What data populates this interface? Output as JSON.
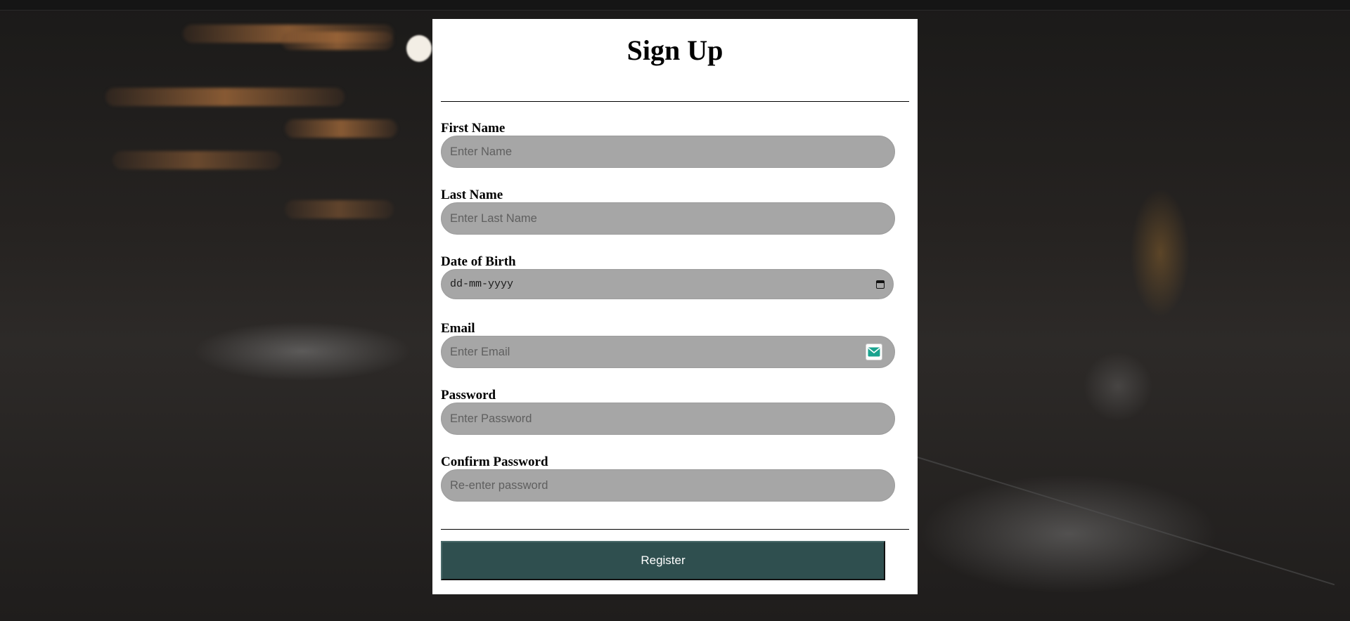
{
  "form": {
    "title": "Sign Up",
    "fields": [
      {
        "label": "First Name",
        "placeholder": "Enter Name",
        "type": "text"
      },
      {
        "label": "Last Name",
        "placeholder": "Enter Last Name",
        "type": "text"
      },
      {
        "label": "Date of Birth",
        "placeholder": "dd-mm-yyyy",
        "type": "date"
      },
      {
        "label": "Email",
        "placeholder": "Enter Email",
        "type": "email"
      },
      {
        "label": "Password",
        "placeholder": "Enter Password",
        "type": "password"
      },
      {
        "label": "Confirm Password",
        "placeholder": "Re-enter password",
        "type": "password"
      }
    ],
    "submit_label": "Register",
    "colors": {
      "card_background": "#ffffff",
      "input_background": "#a6a6a6",
      "button_background": "#2f4f4f",
      "button_text": "#ffffff"
    },
    "icons": {
      "date_field": "calendar-icon",
      "email_field": "email-extension-icon"
    }
  }
}
